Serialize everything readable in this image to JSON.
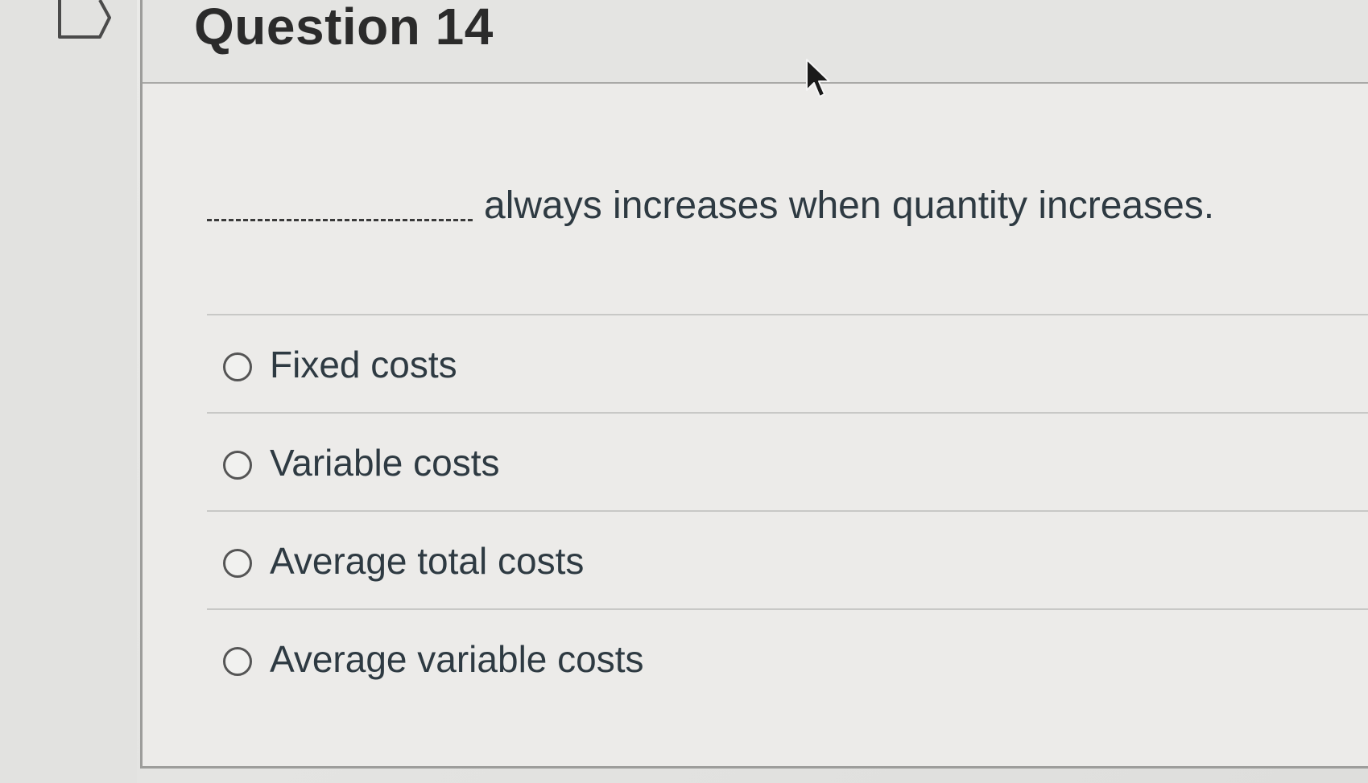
{
  "question": {
    "title": "Question 14",
    "prompt": "always increases when quantity increases."
  },
  "answers": [
    {
      "label": "Fixed costs",
      "selected": false
    },
    {
      "label": "Variable costs",
      "selected": false
    },
    {
      "label": "Average total costs",
      "selected": false
    },
    {
      "label": "Average variable costs",
      "selected": false
    }
  ],
  "icons": {
    "flag": "flag-bookmark-icon",
    "cursor": "mouse-pointer-icon"
  },
  "colors": {
    "background": "#e6e6e4",
    "card": "#ecebe9",
    "text": "#2e3a42",
    "title": "#2b2b2b"
  }
}
